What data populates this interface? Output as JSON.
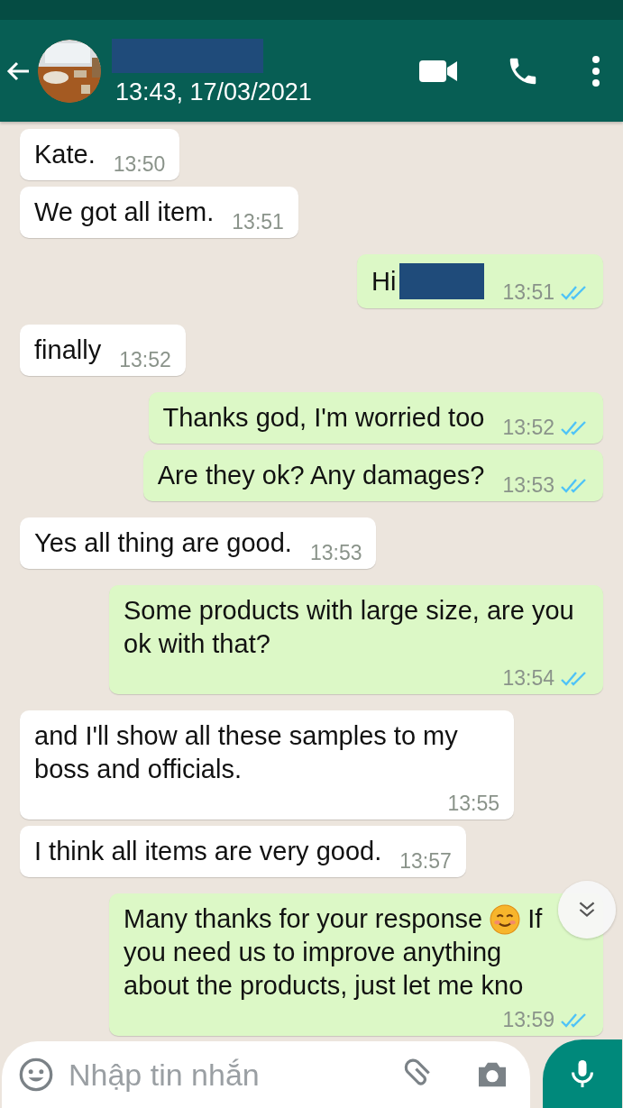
{
  "header": {
    "name_redacted": true,
    "subtitle": "13:43, 17/03/2021"
  },
  "messages": [
    {
      "kind": "incoming",
      "text": "Kate.",
      "time": "13:50"
    },
    {
      "kind": "incoming",
      "text": "We got all item.",
      "time": "13:51"
    },
    {
      "kind": "outgoing",
      "parts": [
        {
          "kind": "text",
          "text": "Hi"
        },
        {
          "kind": "redaction"
        }
      ],
      "time": "13:51",
      "read": true
    },
    {
      "kind": "incoming",
      "text": "finally",
      "time": "13:52"
    },
    {
      "kind": "outgoing",
      "text": "Thanks god, I'm worried too",
      "time": "13:52",
      "read": true
    },
    {
      "kind": "outgoing",
      "text": "Are they ok? Any damages?",
      "time": "13:53",
      "read": true
    },
    {
      "kind": "incoming",
      "text": "Yes all thing are good.",
      "time": "13:53"
    },
    {
      "kind": "outgoing",
      "text": "Some products with large size, are you ok with that?",
      "time": "13:54",
      "read": true
    },
    {
      "kind": "incoming",
      "text": "and I'll show all these samples to my boss and officials.",
      "time": "13:55"
    },
    {
      "kind": "incoming",
      "text": "I think all items are very good.",
      "time": "13:57"
    },
    {
      "kind": "outgoing",
      "lines": [
        [
          {
            "kind": "text",
            "text": "Many thanks for your response"
          },
          {
            "kind": "emoji"
          },
          {
            "kind": "text",
            "text": "If"
          }
        ],
        [
          {
            "kind": "text",
            "text": "you need us to improve anything"
          }
        ],
        [
          {
            "kind": "text",
            "text": "about the products, just let me kno"
          }
        ]
      ],
      "time": "13:59",
      "read": true
    }
  ],
  "composer": {
    "placeholder": "Nhập tin nhắn"
  }
}
